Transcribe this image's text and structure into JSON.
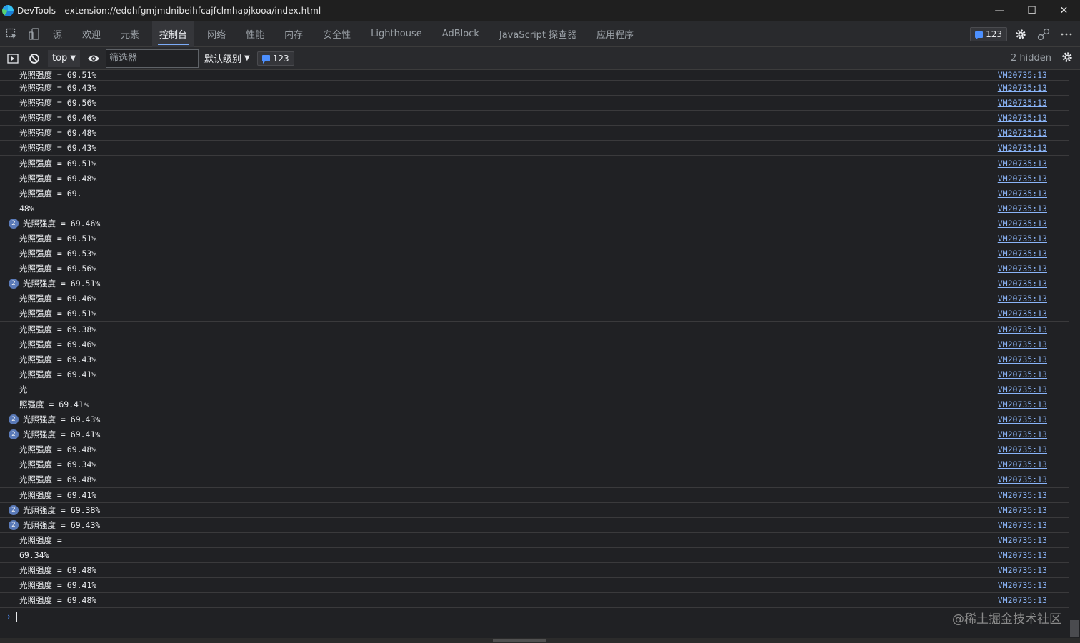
{
  "window": {
    "title": "DevTools - extension://edohfgmjmdnibeihfcajfclmhapjkooa/index.html",
    "minimize": "—",
    "maximize": "☐",
    "close": "✕"
  },
  "tabs": [
    {
      "label": "源"
    },
    {
      "label": "欢迎"
    },
    {
      "label": "元素"
    },
    {
      "label": "控制台"
    },
    {
      "label": "网络"
    },
    {
      "label": "性能"
    },
    {
      "label": "内存"
    },
    {
      "label": "安全性"
    },
    {
      "label": "Lighthouse"
    },
    {
      "label": "AdBlock"
    },
    {
      "label": "JavaScript 探查器"
    },
    {
      "label": "应用程序"
    }
  ],
  "issues_count": "123",
  "toolbar": {
    "context": "top",
    "filter_placeholder": "筛选器",
    "level": "默认级别",
    "count": "123",
    "hidden": "2 hidden"
  },
  "logs": [
    {
      "text": "光照强度 = 69.51%",
      "src": "VM20735:13"
    },
    {
      "text": "光照强度 = 69.43%",
      "src": "VM20735:13"
    },
    {
      "text": "光照强度 = 69.56%",
      "src": "VM20735:13"
    },
    {
      "text": "光照强度 = 69.46%",
      "src": "VM20735:13"
    },
    {
      "text": "光照强度 = 69.48%",
      "src": "VM20735:13"
    },
    {
      "text": "光照强度 = 69.43%",
      "src": "VM20735:13"
    },
    {
      "text": "光照强度 = 69.51%",
      "src": "VM20735:13"
    },
    {
      "text": "光照强度 = 69.48%",
      "src": "VM20735:13"
    },
    {
      "text": "光照强度 = 69.",
      "src": "VM20735:13"
    },
    {
      "text": "48%",
      "src": "VM20735:13"
    },
    {
      "text": "光照强度 = 69.46%",
      "src": "VM20735:13",
      "count": "2"
    },
    {
      "text": "光照强度 = 69.51%",
      "src": "VM20735:13"
    },
    {
      "text": "光照强度 = 69.53%",
      "src": "VM20735:13"
    },
    {
      "text": "光照强度 = 69.56%",
      "src": "VM20735:13"
    },
    {
      "text": "光照强度 = 69.51%",
      "src": "VM20735:13",
      "count": "2"
    },
    {
      "text": "光照强度 = 69.46%",
      "src": "VM20735:13"
    },
    {
      "text": "光照强度 = 69.51%",
      "src": "VM20735:13"
    },
    {
      "text": "光照强度 = 69.38%",
      "src": "VM20735:13"
    },
    {
      "text": "光照强度 = 69.46%",
      "src": "VM20735:13"
    },
    {
      "text": "光照强度 = 69.43%",
      "src": "VM20735:13"
    },
    {
      "text": "光照强度 = 69.41%",
      "src": "VM20735:13"
    },
    {
      "text": "光",
      "src": "VM20735:13"
    },
    {
      "text": "照强度 = 69.41%",
      "src": "VM20735:13"
    },
    {
      "text": "光照强度 = 69.43%",
      "src": "VM20735:13",
      "count": "2"
    },
    {
      "text": "光照强度 = 69.41%",
      "src": "VM20735:13",
      "count": "2"
    },
    {
      "text": "光照强度 = 69.48%",
      "src": "VM20735:13"
    },
    {
      "text": "光照强度 = 69.34%",
      "src": "VM20735:13"
    },
    {
      "text": "光照强度 = 69.48%",
      "src": "VM20735:13"
    },
    {
      "text": "光照强度 = 69.41%",
      "src": "VM20735:13"
    },
    {
      "text": "光照强度 = 69.38%",
      "src": "VM20735:13",
      "count": "2"
    },
    {
      "text": "光照强度 = 69.43%",
      "src": "VM20735:13",
      "count": "2"
    },
    {
      "text": "光照强度 =",
      "src": "VM20735:13"
    },
    {
      "text": "69.34%",
      "src": "VM20735:13"
    },
    {
      "text": "光照强度 = 69.48%",
      "src": "VM20735:13"
    },
    {
      "text": "光照强度 = 69.41%",
      "src": "VM20735:13"
    },
    {
      "text": "光照强度 = 69.48%",
      "src": "VM20735:13"
    }
  ],
  "watermark": "@稀土掘金技术社区",
  "icons": {
    "inspect": "inspect-element-icon",
    "device": "device-toolbar-icon",
    "sidebar": "sidebar-toggle-icon",
    "clear": "clear-console-icon",
    "eye": "live-expression-icon",
    "gear": "settings-icon",
    "connect": "connection-icon",
    "more": "more-options-icon"
  },
  "colors": {
    "accent": "#7cacf8",
    "link": "#8ab4f8",
    "background": "#202124",
    "badge": "#5a7ab8"
  }
}
